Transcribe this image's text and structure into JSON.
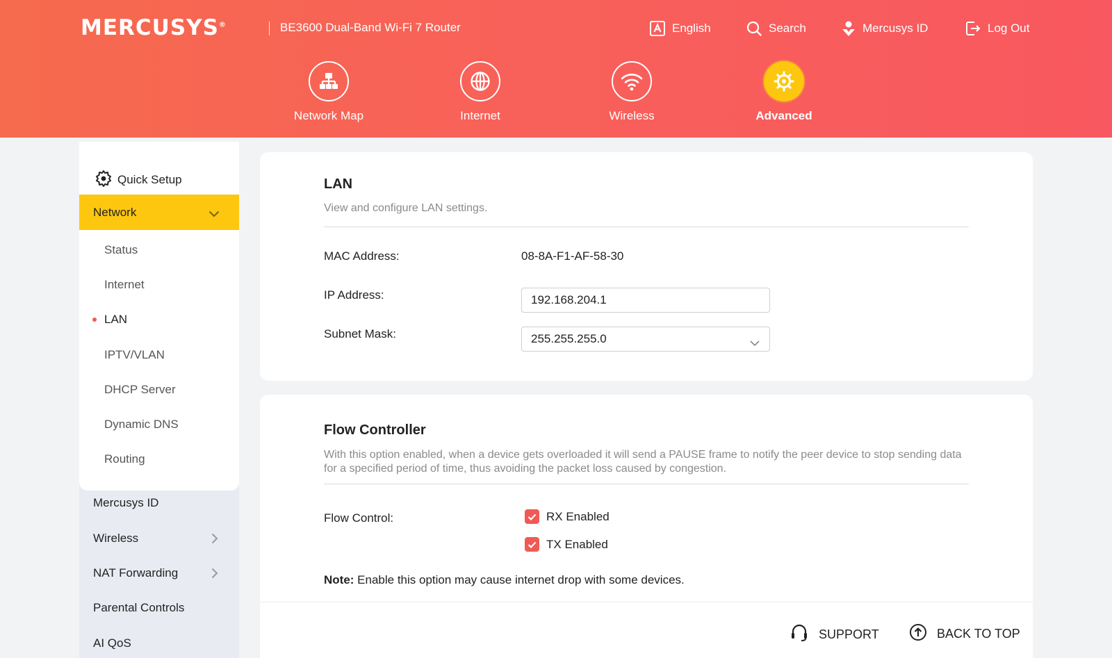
{
  "header": {
    "brand": "MERCUSYS",
    "brand_mark": "®",
    "model": "BE3600 Dual-Band Wi-Fi 7 Router",
    "links": {
      "language": "English",
      "search": "Search",
      "account": "Mercusys ID",
      "logout": "Log Out"
    },
    "nav": [
      {
        "label": "Network Map",
        "icon": "network-map-icon"
      },
      {
        "label": "Internet",
        "icon": "globe-icon"
      },
      {
        "label": "Wireless",
        "icon": "wifi-icon"
      },
      {
        "label": "Advanced",
        "icon": "gear-icon",
        "active": true
      }
    ]
  },
  "sidebar": {
    "quick_setup": "Quick Setup",
    "network": "Network",
    "network_items": [
      "Status",
      "Internet",
      "LAN",
      "IPTV/VLAN",
      "DHCP Server",
      "Dynamic DNS",
      "Routing"
    ],
    "active_item": "LAN",
    "main_items": [
      "Mercusys ID",
      "Wireless",
      "NAT Forwarding",
      "Parental Controls",
      "AI QoS"
    ]
  },
  "lan": {
    "title": "LAN",
    "description": "View and configure LAN settings.",
    "mac_label": "MAC Address:",
    "mac_value": "08-8A-F1-AF-58-30",
    "ip_label": "IP Address:",
    "ip_value": "192.168.204.1",
    "subnet_label": "Subnet Mask:",
    "subnet_value": "255.255.255.0"
  },
  "flow": {
    "title": "Flow Controller",
    "description": "With this option enabled, when a device gets overloaded it will send a PAUSE frame to notify the peer device to stop sending data for a specified period of time, thus avoiding the packet loss caused by congestion.",
    "label": "Flow Control:",
    "rx_label": "RX Enabled",
    "rx_checked": true,
    "tx_label": "TX Enabled",
    "tx_checked": true,
    "note_prefix": "Note:",
    "note_text": " Enable this option may cause internet drop with some devices."
  },
  "footer": {
    "support": "SUPPORT",
    "back_to_top": "BACK TO TOP"
  },
  "colors": {
    "header_gradient_start": "#f66a4d",
    "header_gradient_end": "#f8585f",
    "accent_yellow": "#fdc70f",
    "checkbox_red": "#f05a55"
  }
}
